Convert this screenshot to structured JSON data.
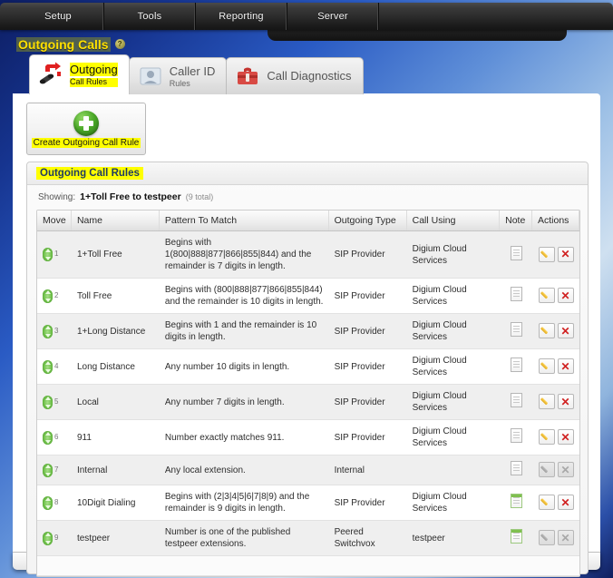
{
  "topnav": {
    "items": [
      {
        "label": "Setup"
      },
      {
        "label": "Tools"
      },
      {
        "label": "Reporting"
      },
      {
        "label": "Server"
      }
    ]
  },
  "page": {
    "title": "Outgoing Calls",
    "help_icon": "?"
  },
  "tabs": [
    {
      "title": "Outgoing",
      "subtitle": "Call Rules",
      "icon": "phones-icon",
      "active": true
    },
    {
      "title": "Caller ID",
      "subtitle": "Rules",
      "icon": "contact-icon",
      "active": false
    },
    {
      "title": "Call Diagnostics",
      "subtitle": "",
      "icon": "toolbox-icon",
      "active": false
    }
  ],
  "create_button": {
    "label": "Create Outgoing Call Rule",
    "icon": "plus-circle-icon"
  },
  "section": {
    "title": "Outgoing Call Rules",
    "showing_label": "Showing:",
    "showing_value": "1+Toll Free to testpeer",
    "showing_total": "(9 total)"
  },
  "table": {
    "columns": [
      "Move",
      "Name",
      "Pattern To Match",
      "Outgoing Type",
      "Call Using",
      "Note",
      "Actions"
    ],
    "rows": [
      {
        "move": "1",
        "name": "1+Toll Free",
        "pattern": "Begins with 1(800|888|877|866|855|844) and the remainder is 7 digits in length.",
        "type": "SIP Provider",
        "using": "Digium Cloud Services",
        "note": false,
        "actions_enabled": true
      },
      {
        "move": "2",
        "name": "Toll Free",
        "pattern": "Begins with (800|888|877|866|855|844) and the remainder is 10 digits in length.",
        "type": "SIP Provider",
        "using": "Digium Cloud Services",
        "note": false,
        "actions_enabled": true
      },
      {
        "move": "3",
        "name": "1+Long Distance",
        "pattern": "Begins with 1 and the remainder is 10 digits in length.",
        "type": "SIP Provider",
        "using": "Digium Cloud Services",
        "note": false,
        "actions_enabled": true
      },
      {
        "move": "4",
        "name": "Long Distance",
        "pattern": "Any number 10 digits in length.",
        "type": "SIP Provider",
        "using": "Digium Cloud Services",
        "note": false,
        "actions_enabled": true
      },
      {
        "move": "5",
        "name": "Local",
        "pattern": "Any number 7 digits in length.",
        "type": "SIP Provider",
        "using": "Digium Cloud Services",
        "note": false,
        "actions_enabled": true
      },
      {
        "move": "6",
        "name": "911",
        "pattern": "Number exactly matches 911.",
        "type": "SIP Provider",
        "using": "Digium Cloud Services",
        "note": false,
        "actions_enabled": true
      },
      {
        "move": "7",
        "name": "Internal",
        "pattern": "Any local extension.",
        "type": "Internal",
        "using": "",
        "note": false,
        "actions_enabled": false
      },
      {
        "move": "8",
        "name": "10Digit Dialing",
        "pattern": "Begins with (2|3|4|5|6|7|8|9) and the remainder is 9 digits in length.",
        "type": "SIP Provider",
        "using": "Digium Cloud Services",
        "note": true,
        "actions_enabled": true
      },
      {
        "move": "9",
        "name": "testpeer",
        "pattern": "Number is one of the published testpeer extensions.",
        "type": "Peered Switchvox",
        "using": "testpeer",
        "note": true,
        "actions_enabled": false
      }
    ]
  },
  "icons": {
    "edit": "pencil-icon",
    "delete": "red-x-icon",
    "note": "note-page-icon",
    "move": "move-updown-icon"
  },
  "colors": {
    "highlight": "#ffff00",
    "title_text": "#ffe000",
    "section_title": "#1f3a63",
    "delete": "#d02020",
    "accent_green": "#4aa828"
  }
}
